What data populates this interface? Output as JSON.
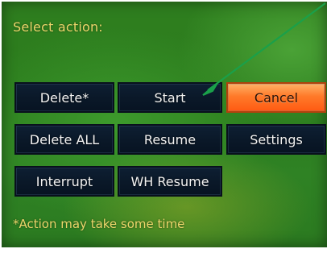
{
  "prompt": "Select action:",
  "buttons": {
    "delete": "Delete*",
    "start": "Start",
    "cancel": "Cancel",
    "delete_all": "Delete ALL",
    "resume": "Resume",
    "settings": "Settings",
    "interrupt": "Interrupt",
    "wh_resume": "WH Resume"
  },
  "footnote": "*Action may take some time",
  "colors": {
    "accent_text": "#ecd66b",
    "button_bg": "#0a1828",
    "selected_bg": "#ff6a1a",
    "annotation_arrow": "#1aa04a"
  },
  "annotation": {
    "icon": "arrow-pointer-icon"
  }
}
